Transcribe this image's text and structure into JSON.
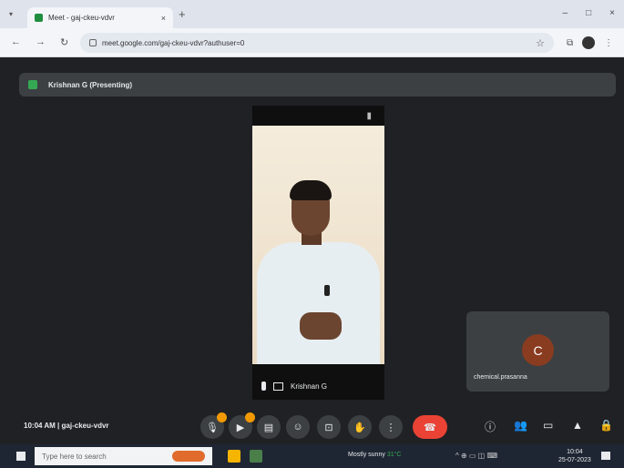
{
  "browser": {
    "tab_title": "Meet - gaj-ckeu-vdvr",
    "tab_close": "×",
    "new_tab": "+",
    "url": "meet.google.com/gaj-ckeu-vdvr?authuser=0",
    "win_minimize": "–",
    "win_maximize": "□",
    "win_close": "×"
  },
  "meet": {
    "presenting_label": "Krishnan G (Presenting)",
    "presenter_name": "Krishnan G",
    "self_initial": "C",
    "self_name": "chemical.prasanna",
    "time": "10:04 AM",
    "meeting_code": "gaj-ckeu-vdvr"
  },
  "taskbar": {
    "search_placeholder": "Type here to search",
    "weather": "Mostly sunny",
    "weather_temp": "31°C",
    "time": "10:04",
    "date": "25-07-2023"
  },
  "colors": {
    "end_call": "#ea4335",
    "badge": "#f29900",
    "self_avatar": "#8a3c20"
  }
}
